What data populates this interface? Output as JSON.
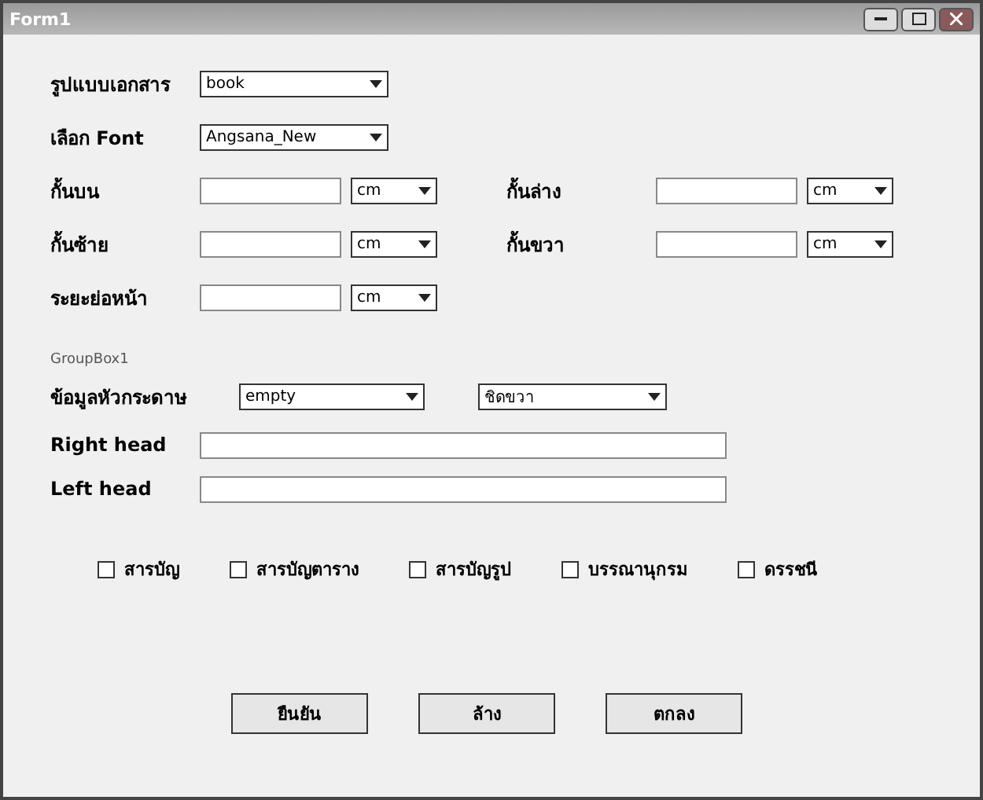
{
  "window": {
    "title": "Form1"
  },
  "fields": [
    {
      "label": "รูปแบบเอกสาร",
      "value": "book"
    },
    {
      "label": "เลือก Font",
      "value": "Angsana_New"
    }
  ],
  "margins": [
    {
      "label": "กั้นบน",
      "unit": "cm"
    },
    {
      "label": "กั้นล่าง",
      "unit": "cm"
    },
    {
      "label": "กั้นซ้าย",
      "unit": "cm"
    },
    {
      "label": "กั้นขวา",
      "unit": "cm"
    },
    {
      "label": "ระยะย่อหน้า",
      "unit": "cm"
    }
  ],
  "group": {
    "title": "GroupBox1",
    "header_label": "ข้อมูลหัวกระดาษ",
    "header_value": "empty",
    "align_value": "ชิดขวา",
    "rows": [
      {
        "label": "Right head"
      },
      {
        "label": "Left head"
      }
    ]
  },
  "options": [
    {
      "label": "สารบัญ",
      "checked": false
    },
    {
      "label": "สารบัญตาราง",
      "checked": false
    },
    {
      "label": "สารบัญรูป",
      "checked": false
    },
    {
      "label": "บรรณานุกรม",
      "checked": false
    },
    {
      "label": "ดรรชนี",
      "checked": false
    }
  ],
  "buttons": [
    "ยืนยัน",
    "ล้าง",
    "ตกลง"
  ]
}
